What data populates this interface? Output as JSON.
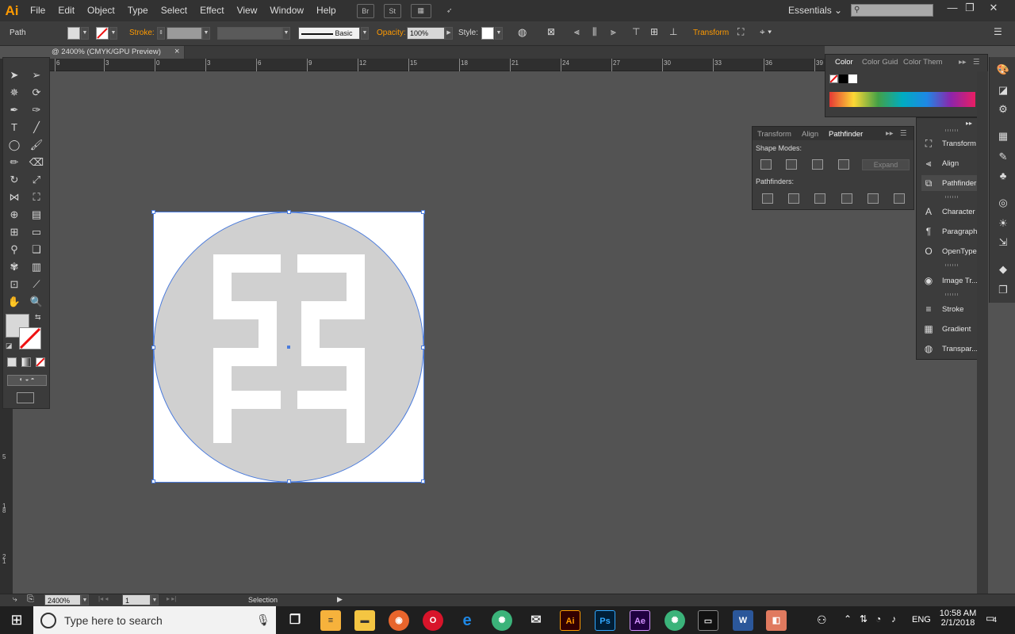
{
  "app": {
    "logo": "Ai"
  },
  "menu": [
    "File",
    "Edit",
    "Object",
    "Type",
    "Select",
    "Effect",
    "View",
    "Window",
    "Help"
  ],
  "menubar_icons": {
    "bridge": "Br",
    "stock": "St"
  },
  "workspace": "Essentials",
  "window_controls": {
    "minimize": "—",
    "restore": "❐",
    "close": "✕"
  },
  "control_bar": {
    "selection_type": "Path",
    "stroke_label": "Stroke:",
    "brush": "Basic",
    "opacity_label": "Opacity:",
    "opacity_value": "100%",
    "style_label": "Style:",
    "transform_label": "Transform"
  },
  "document_tab": {
    "title": "@ 2400% (CMYK/GPU Preview)",
    "close": "×"
  },
  "ruler_h": [
    "6",
    "3",
    "0",
    "3",
    "6",
    "9",
    "12",
    "15",
    "18",
    "21",
    "24",
    "27",
    "30",
    "33",
    "36",
    "39"
  ],
  "ruler_v": [
    "1",
    "5",
    "1",
    "8",
    "2",
    "1"
  ],
  "color_panel": {
    "tabs": [
      "Color",
      "Color Guid",
      "Color Them"
    ]
  },
  "pathfinder_panel": {
    "tabs": [
      "Transform",
      "Align",
      "Pathfinder"
    ],
    "shape_modes_label": "Shape Modes:",
    "expand_label": "Expand",
    "pathfinders_label": "Pathfinders:"
  },
  "dock_items": [
    {
      "label": "Transform",
      "icon": "transform-icon"
    },
    {
      "label": "Align",
      "icon": "align-icon"
    },
    {
      "label": "Pathfinder",
      "icon": "pathfinder-icon"
    },
    {
      "label": "Character",
      "icon": "character-icon"
    },
    {
      "label": "Paragraph",
      "icon": "paragraph-icon"
    },
    {
      "label": "OpenType",
      "icon": "opentype-icon"
    },
    {
      "label": "Image Tr...",
      "icon": "image-trace-icon"
    },
    {
      "label": "Stroke",
      "icon": "stroke-icon"
    },
    {
      "label": "Gradient",
      "icon": "gradient-icon"
    },
    {
      "label": "Transpar...",
      "icon": "transparency-icon"
    }
  ],
  "status_bar": {
    "zoom": "2400%",
    "artboard": "1",
    "mode": "Selection"
  },
  "taskbar": {
    "search_placeholder": "Type here to search",
    "lang": "ENG",
    "time": "10:58 AM",
    "date": "2/1/2018",
    "notifications": "4",
    "apps": [
      "Ai",
      "Ps",
      "Ae"
    ]
  },
  "colors": {
    "accent": "#ff9a00",
    "selection": "#4a7bdc",
    "artwork_circle": "#d0d0d0"
  }
}
